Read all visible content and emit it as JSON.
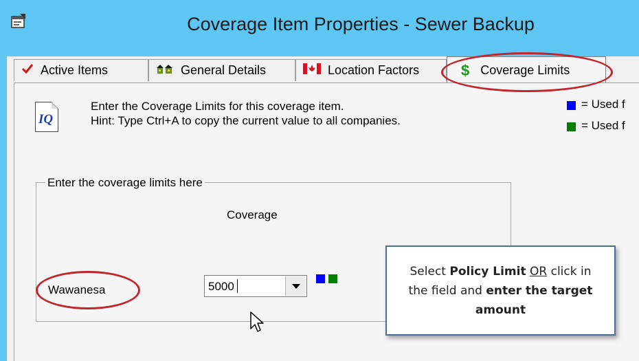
{
  "window": {
    "title": "Coverage Item Properties - Sewer Backup",
    "icon": "properties-window-icon"
  },
  "tabs": [
    {
      "label": "Active Items",
      "icon": "checkmark-icon",
      "active": false
    },
    {
      "label": "General Details",
      "icon": "houses-icon",
      "active": false
    },
    {
      "label": "Location Factors",
      "icon": "canada-flag-icon",
      "active": false
    },
    {
      "label": "Coverage Limits",
      "icon": "dollar-icon",
      "active": true
    }
  ],
  "instructions": {
    "line1": "Enter the Coverage Limits for this coverage item.",
    "line2": "Hint: Type Ctrl+A to copy the current value to all companies.",
    "icon_label": "IQ"
  },
  "legend": [
    {
      "text": "= Used f",
      "color": "#0000ff"
    },
    {
      "text": "= Used f",
      "color": "#008000"
    }
  ],
  "group": {
    "label": "Enter the coverage limits here",
    "column_header": "Coverage",
    "rows": [
      {
        "company": "Wawanesa",
        "value": "5000"
      }
    ]
  },
  "callout": {
    "p1": "Select ",
    "b1": "Policy Limit",
    "or": "OR",
    "p2": " click in the field and ",
    "b2": "enter the target amount"
  },
  "colors": {
    "title_bar": "#5ec6f2",
    "highlight": "#c0262c",
    "indicator_blue": "#0000ff",
    "indicator_green": "#008000"
  }
}
